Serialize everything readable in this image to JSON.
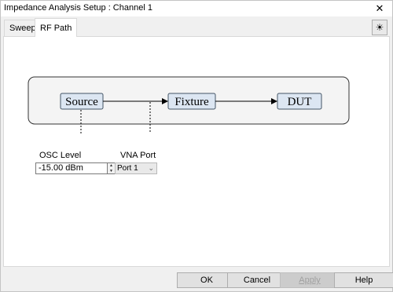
{
  "window": {
    "title": "Impedance Analysis Setup : Channel 1",
    "close_glyph": "✕"
  },
  "tabs": [
    {
      "label": "Sweep",
      "active": false
    },
    {
      "label": "RF Path",
      "active": true
    }
  ],
  "toolbar": {
    "sun_icon": "sun-icon",
    "sun_glyph": "☀"
  },
  "diagram": {
    "nodes": [
      "Source",
      "Fixture",
      "DUT"
    ]
  },
  "form": {
    "osc_level_label": "OSC Level",
    "osc_level_value": "-15.00 dBm",
    "vna_port_label": "VNA Port",
    "vna_port_value": "Port 1"
  },
  "buttons": {
    "ok": "OK",
    "cancel": "Cancel",
    "apply": "Apply",
    "help": "Help"
  },
  "colors": {
    "node_fill": "#dce6f2",
    "node_border": "#445566",
    "panel_bg": "#ffffff",
    "dialog_bg": "#f0f0f0"
  }
}
